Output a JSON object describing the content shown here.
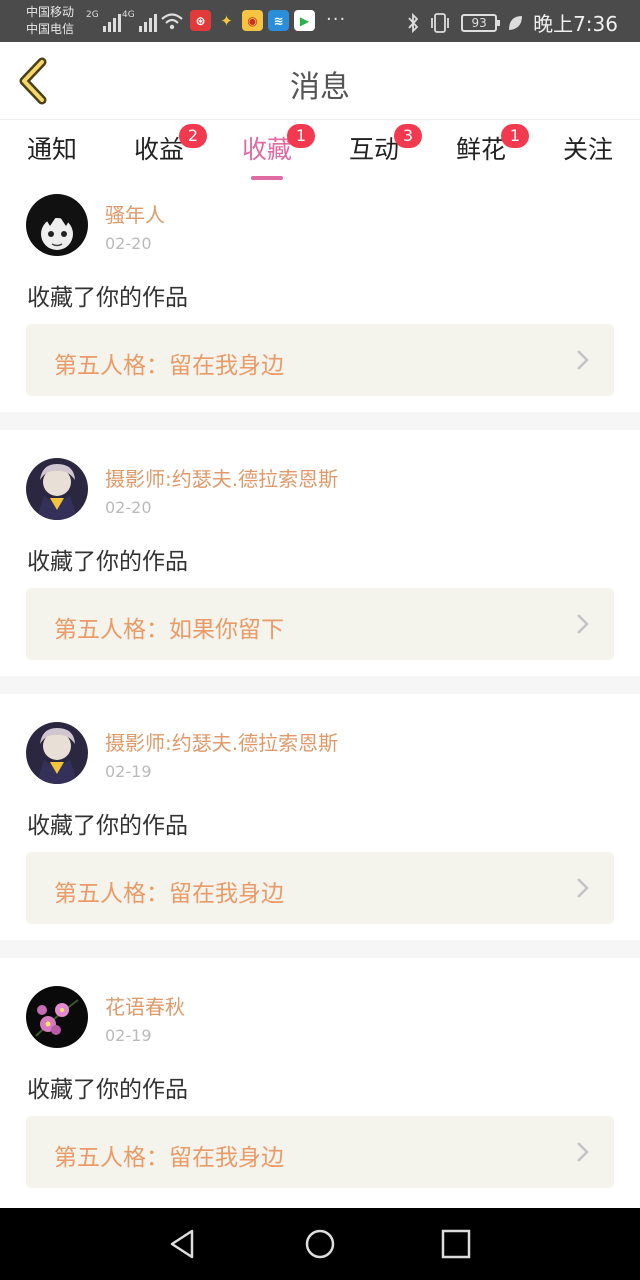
{
  "status_bar": {
    "carrier_1": "中国移动",
    "carrier_2": "中国电信",
    "net_1": "2G",
    "net_2": "4G",
    "battery": "93",
    "time": "晚上7:36",
    "dots": "···"
  },
  "header": {
    "title": "消息"
  },
  "tabs": [
    {
      "label": "通知",
      "badge": ""
    },
    {
      "label": "收益",
      "badge": "2"
    },
    {
      "label": "收藏",
      "badge": "1"
    },
    {
      "label": "互动",
      "badge": "3"
    },
    {
      "label": "鲜花",
      "badge": "1"
    },
    {
      "label": "关注",
      "badge": ""
    }
  ],
  "active_tab": "收藏",
  "colors": {
    "accent": "#e06aa2",
    "username": "#e09a6a",
    "work_title": "#e99b68",
    "badge": "#f2394f"
  },
  "items": [
    {
      "user": "骚年人",
      "date": "02-20",
      "action": "收藏了你的作品",
      "work": "第五人格：留在我身边"
    },
    {
      "user": "摄影师:约瑟夫.德拉索恩斯",
      "date": "02-20",
      "action": "收藏了你的作品",
      "work": "第五人格：如果你留下"
    },
    {
      "user": "摄影师:约瑟夫.德拉索恩斯",
      "date": "02-19",
      "action": "收藏了你的作品",
      "work": "第五人格：留在我身边"
    },
    {
      "user": "花语春秋",
      "date": "02-19",
      "action": "收藏了你的作品",
      "work": "第五人格：留在我身边"
    }
  ]
}
